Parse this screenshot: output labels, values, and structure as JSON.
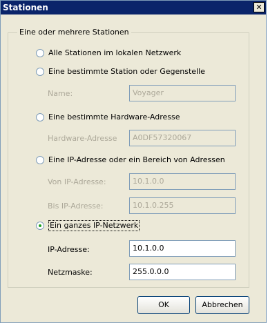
{
  "window": {
    "title": "Stationen",
    "close_symbol": "✕"
  },
  "group": {
    "legend": "Eine oder mehrere Stationen"
  },
  "options": {
    "all_local": "Alle Stationen im lokalen Netzwerk",
    "specific_station": "Eine bestimmte Station oder Gegenstelle",
    "hardware_address": "Eine bestimmte Hardware-Adresse",
    "ip_range": "Eine IP-Adresse oder ein Bereich von Adressen",
    "ip_network": "Ein ganzes IP-Netzwerk"
  },
  "selected_option": "ip_network",
  "fields": {
    "name": {
      "label": "Name:",
      "value": "Voyager"
    },
    "hardware": {
      "label": "Hardware-Adresse",
      "value": "A0DF57320067"
    },
    "from_ip": {
      "label": "Von IP-Adresse:",
      "value": "10.1.0.0"
    },
    "to_ip": {
      "label": "Bis IP-Adresse:",
      "value": "10.1.0.255"
    },
    "ip_address": {
      "label": "IP-Adresse:",
      "value": "10.1.0.0"
    },
    "netmask": {
      "label": "Netzmaske:",
      "value": "255.0.0.0"
    }
  },
  "buttons": {
    "ok": "OK",
    "cancel": "Abbrechen"
  },
  "colors": {
    "titlebar": "#0a246a",
    "dialog_bg": "#ece9d8",
    "disabled_text": "#aca899",
    "radio_dot": "#21a121"
  }
}
